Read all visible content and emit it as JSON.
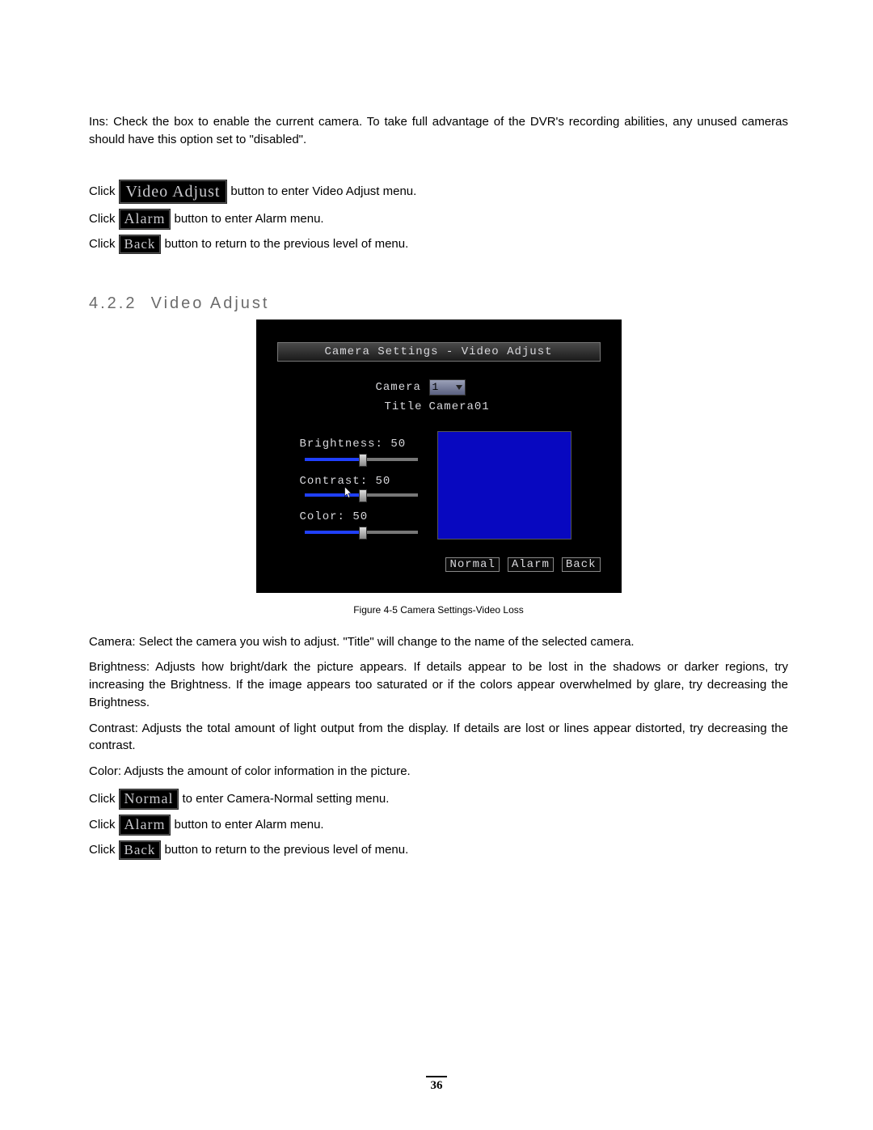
{
  "intro": {
    "ins_label": "Ins:",
    "ins_text": " Check the box to enable the current camera. To take full advantage of the DVR's recording abilities, any unused cameras should have this option set to \"disabled\"."
  },
  "click_word": "Click ",
  "buttons": {
    "video_adjust": "Video Adjust",
    "alarm": "Alarm",
    "back": "Back",
    "normal": "Normal"
  },
  "click_tail": {
    "video_adjust": " button to enter Video Adjust menu.",
    "alarm": " button to enter Alarm menu.",
    "back": " button to return to the previous level of menu.",
    "normal": " to enter Camera-Normal setting menu."
  },
  "section": {
    "number": "4.2.2",
    "title": "Video Adjust"
  },
  "dvr": {
    "titlebar": "Camera Settings - Video Adjust",
    "camera_label": "Camera",
    "camera_value": "1",
    "title_label": "Title",
    "title_value": "Camera01",
    "brightness_label": "Brightness:",
    "brightness_value": "50",
    "contrast_label": "Contrast:",
    "contrast_value": "50",
    "color_label": "Color:",
    "color_value": "50",
    "slider_pct": 50,
    "btn_normal": "Normal",
    "btn_alarm": "Alarm",
    "btn_back": "Back"
  },
  "figure_caption": "Figure 4-5  Camera Settings-Video Loss",
  "defs": {
    "camera_term": "Camera:",
    "camera_text": " Select the camera you wish to adjust. \"Title\" will change to the name of the selected camera.",
    "brightness_term": "Brightness:",
    "brightness_text": " Adjusts how bright/dark the picture appears.  If details appear to be lost in the shadows or darker regions, try increasing the Brightness.  If the image appears too saturated or if the colors appear overwhelmed by glare, try decreasing the Brightness.",
    "contrast_term": "Contrast:",
    "contrast_text": " Adjusts the total amount of light output from the display. If details are lost or lines appear distorted, try decreasing the contrast.",
    "color_term": "Color:",
    "color_text": " Adjusts the amount of color information in the picture."
  },
  "page_number": "36"
}
